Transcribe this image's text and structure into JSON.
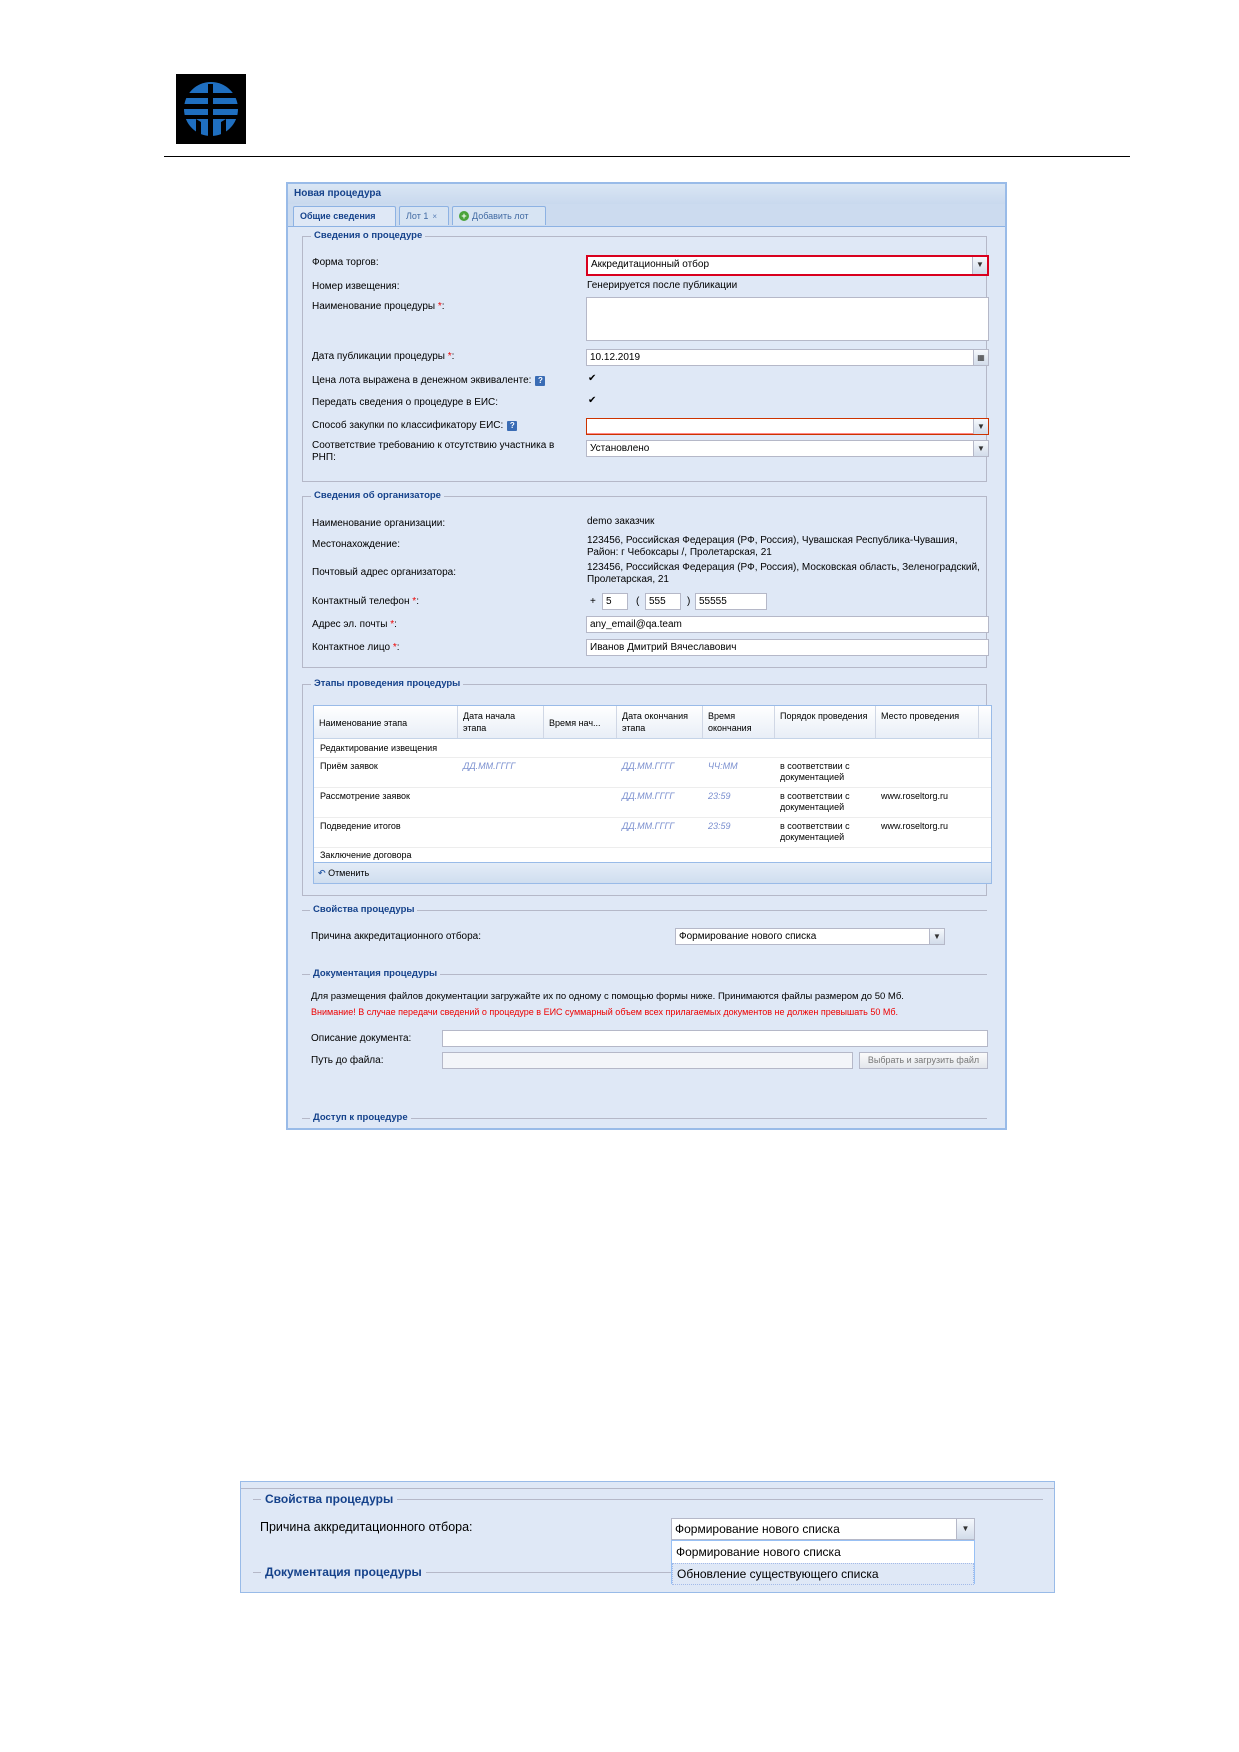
{
  "window": {
    "title": "Новая процедура",
    "tabs": [
      {
        "label": "Общие сведения"
      },
      {
        "label": "Лот 1",
        "close": "×"
      },
      {
        "label": "Добавить лот",
        "icon": "add-icon"
      }
    ]
  },
  "procedure_info": {
    "legend": "Сведения о процедуре",
    "trade_form": {
      "label": "Форма торгов:",
      "value": "Аккредитационный отбор"
    },
    "notice_number": {
      "label": "Номер извещения:",
      "value": "Генерируется после публикации"
    },
    "procedure_name": {
      "label": "Наименование процедуры",
      "required": "*",
      "colon": ":",
      "value": ""
    },
    "publication_date": {
      "label": "Дата публикации процедуры",
      "required": "*",
      "colon": ":",
      "value": "10.12.2019"
    },
    "lot_price_money": {
      "label": "Цена лота выражена в денежном эквиваленте:",
      "checked": "✔"
    },
    "send_to_eis": {
      "label": "Передать сведения о процедуре в ЕИС:",
      "checked": "✔"
    },
    "purchase_method": {
      "label": "Способ закупки по классификатору ЕИС:",
      "value": ""
    },
    "rnp_compliance": {
      "label": "Соответствие требованию к отсутствию участника в РНП:",
      "value": "Установлено"
    }
  },
  "organizer_info": {
    "legend": "Сведения об организаторе",
    "org_name": {
      "label": "Наименование организации:",
      "value": "demo заказчик"
    },
    "location": {
      "label": "Местонахождение:",
      "value": "123456, Российская Федерация (РФ, Россия), Чувашская Республика-Чувашия, Район: г Чебоксары /, Пролетарская, 21"
    },
    "postal_address": {
      "label": "Почтовый адрес организатора:",
      "value": "123456, Российская Федерация (РФ, Россия), Московская область, Зеленоградский, Пролетарская, 21"
    },
    "phone": {
      "label": "Контактный телефон",
      "required": "*",
      "colon": ":",
      "plus": "+",
      "country": "5",
      "open_paren": "(",
      "code": "555",
      "close_paren": ")",
      "number": "55555"
    },
    "email": {
      "label": "Адрес эл. почты",
      "required": "*",
      "colon": ":",
      "value": "any_email@qa.team"
    },
    "contact": {
      "label": "Контактное лицо",
      "required": "*",
      "colon": ":",
      "value": "Иванов Дмитрий Вячеславович"
    }
  },
  "stages": {
    "legend": "Этапы проведения процедуры",
    "columns": [
      {
        "label": "Наименование этапа"
      },
      {
        "label": "Дата начала этапа"
      },
      {
        "label": "Время нач..."
      },
      {
        "label": "Дата окончания этапа"
      },
      {
        "label": "Время окончания"
      },
      {
        "label": "Порядок проведения"
      },
      {
        "label": "Место проведения"
      }
    ],
    "rows": [
      {
        "name": "Редактирование извещения",
        "start_date": "",
        "start_time": "",
        "end_date": "",
        "end_time": "",
        "order": "",
        "place": ""
      },
      {
        "name": "Приём заявок",
        "start_date": "ДД.ММ.ГГГГ",
        "start_time": "",
        "end_date": "ДД.ММ.ГГГГ",
        "end_time": "ЧЧ:ММ",
        "order": "в соответствии с документацией",
        "place": ""
      },
      {
        "name": "Рассмотрение заявок",
        "start_date": "",
        "start_time": "",
        "end_date": "ДД.ММ.ГГГГ",
        "end_time": "23:59",
        "order": "в соответствии с документацией",
        "place": "www.roseltorg.ru"
      },
      {
        "name": "Подведение итогов",
        "start_date": "",
        "start_time": "",
        "end_date": "ДД.ММ.ГГГГ",
        "end_time": "23:59",
        "order": "в соответствии с документацией",
        "place": "www.roseltorg.ru"
      },
      {
        "name": "Заключение договора",
        "start_date": "",
        "start_time": "",
        "end_date": "",
        "end_time": "",
        "order": "",
        "place": ""
      }
    ],
    "cancel_label": "Отменить"
  },
  "properties": {
    "legend": "Свойства процедуры",
    "reason": {
      "label": "Причина аккредитационного отбора:",
      "value": "Формирование нового списка"
    }
  },
  "documentation": {
    "legend": "Документация процедуры",
    "info": "Для размещения файлов документации загружайте их по одному с помощью формы ниже. Принимаются файлы размером до 50 Мб.",
    "warning": "Внимание! В случае передачи сведений о процедуре в ЕИС суммарный объем всех прилагаемых документов не должен превышать 50 Мб.",
    "description_label": "Описание документа:",
    "file_label": "Путь до файла:",
    "upload_button": "Выбрать и загрузить файл"
  },
  "access": {
    "legend": "Доступ к процедуре"
  },
  "zoom_view": {
    "properties_legend": "Свойства процедуры",
    "reason_label": "Причина аккредитационного отбора:",
    "reason_value": "Формирование нового списка",
    "options": [
      "Формирование нового списка",
      "Обновление существующего списка"
    ],
    "doc_legend": "Документация процедуры"
  },
  "colors": {
    "accent": "#15428b",
    "panel": "#dfe8f6",
    "border": "#99bbe8",
    "error": "#d9001e"
  }
}
